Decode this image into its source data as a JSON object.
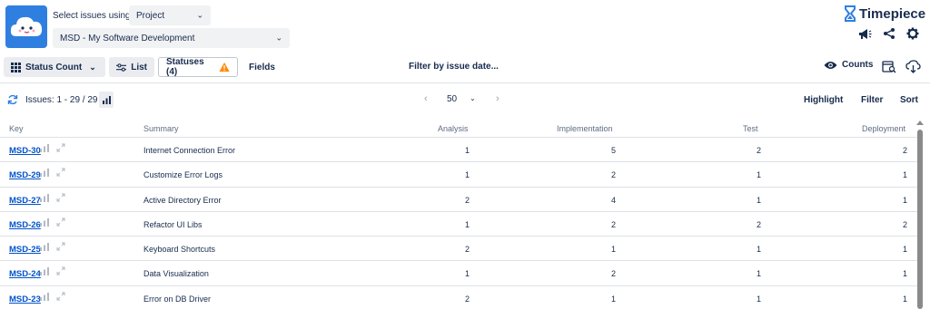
{
  "header": {
    "select_label": "Select issues using",
    "mode_value": "Project",
    "project_value": "MSD - My Software Development",
    "brand_name": "Timepiece"
  },
  "toolbar": {
    "status_count_label": "Status Count",
    "list_label": "List",
    "statuses_label": "Statuses (4)",
    "fields_label": "Fields",
    "filter_date_label": "Filter by issue date...",
    "counts_label": "Counts"
  },
  "pager": {
    "issues_count": "Issues: 1 - 29 / 29",
    "page_size": "50",
    "prev": "‹",
    "next": "›",
    "highlight_label": "Highlight",
    "filter_label": "Filter",
    "sort_label": "Sort"
  },
  "table": {
    "headers": {
      "key": "Key",
      "summary": "Summary",
      "analysis": "Analysis",
      "implementation": "Implementation",
      "test": "Test",
      "deployment": "Deployment"
    },
    "rows": [
      {
        "key": "MSD-30",
        "summary": "Internet Connection Error",
        "analysis": "1",
        "implementation": "5",
        "test": "2",
        "deployment": "2"
      },
      {
        "key": "MSD-29",
        "summary": "Customize Error Logs",
        "analysis": "1",
        "implementation": "2",
        "test": "1",
        "deployment": "1"
      },
      {
        "key": "MSD-27",
        "summary": "Active Directory Error",
        "analysis": "2",
        "implementation": "4",
        "test": "1",
        "deployment": "1"
      },
      {
        "key": "MSD-26",
        "summary": "Refactor UI Libs",
        "analysis": "1",
        "implementation": "2",
        "test": "2",
        "deployment": "2"
      },
      {
        "key": "MSD-25",
        "summary": "Keyboard Shortcuts",
        "analysis": "2",
        "implementation": "1",
        "test": "1",
        "deployment": "1"
      },
      {
        "key": "MSD-24",
        "summary": "Data Visualization",
        "analysis": "1",
        "implementation": "2",
        "test": "1",
        "deployment": "1"
      },
      {
        "key": "MSD-23",
        "summary": "Error on DB Driver",
        "analysis": "2",
        "implementation": "1",
        "test": "1",
        "deployment": "1"
      }
    ]
  },
  "icons": {
    "logo": "cloud-mascot-icon",
    "brand": "hourglass-icon",
    "announce": "megaphone-icon",
    "share": "share-icon",
    "settings": "gear-icon",
    "grid": "grid-icon",
    "list": "sliders-icon",
    "warning": "warning-icon",
    "eye": "eye-icon",
    "refresh": "refresh-icon",
    "bars": "bar-chart-icon",
    "expand": "expand-icon"
  },
  "colors": {
    "accent": "#2f7fe0",
    "link": "#0052cc",
    "warning": "#ff8b00",
    "text": "#172b4d"
  }
}
